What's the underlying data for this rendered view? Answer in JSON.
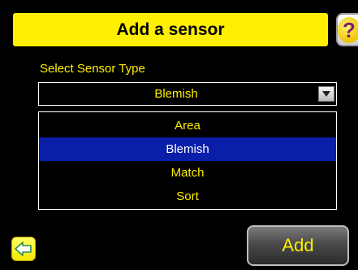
{
  "header": {
    "title": "Add a sensor",
    "help_icon": "question-mark-icon",
    "help_glyph": "?"
  },
  "sensor_type": {
    "label": "Select Sensor Type",
    "selected": "Blemish",
    "options": [
      "Area",
      "Blemish",
      "Match",
      "Sort"
    ]
  },
  "footer": {
    "back_icon": "back-arrow-icon",
    "add_label": "Add"
  },
  "colors": {
    "background": "#000000",
    "accent_yellow": "#ffef00",
    "selection_blue": "#0a1fa8"
  }
}
